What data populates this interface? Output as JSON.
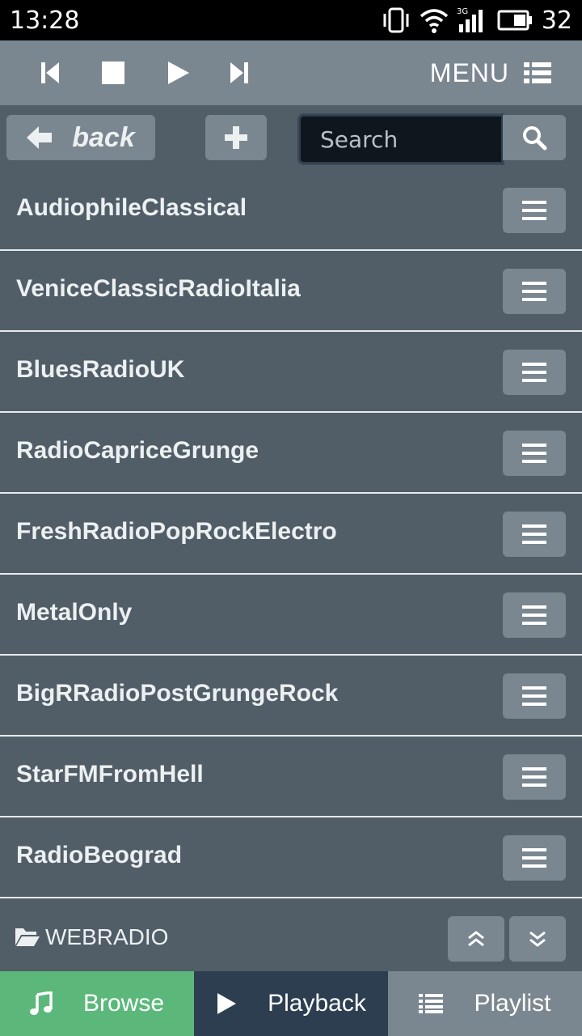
{
  "status": {
    "time": "13:28",
    "battery": "32",
    "network": "3G"
  },
  "player": {
    "menu_label": "MENU"
  },
  "toolbar": {
    "back_label": "back",
    "search_placeholder": "Search"
  },
  "stations": [
    {
      "name": "AudiophileClassical"
    },
    {
      "name": "VeniceClassicRadioItalia"
    },
    {
      "name": "BluesRadioUK"
    },
    {
      "name": "RadioCapriceGrunge"
    },
    {
      "name": "FreshRadioPopRockElectro"
    },
    {
      "name": "MetalOnly"
    },
    {
      "name": "BigRRadioPostGrungeRock"
    },
    {
      "name": "StarFMFromHell"
    },
    {
      "name": "RadioBeograd"
    }
  ],
  "folder": {
    "label": "WEBRADIO"
  },
  "nav": {
    "browse_label": "Browse",
    "playback_label": "Playback",
    "playlist_label": "Playlist"
  },
  "colors": {
    "background": "#515e68",
    "button": "#7b8790",
    "browse_active": "#5cb87a",
    "playback": "#2c3e50"
  }
}
